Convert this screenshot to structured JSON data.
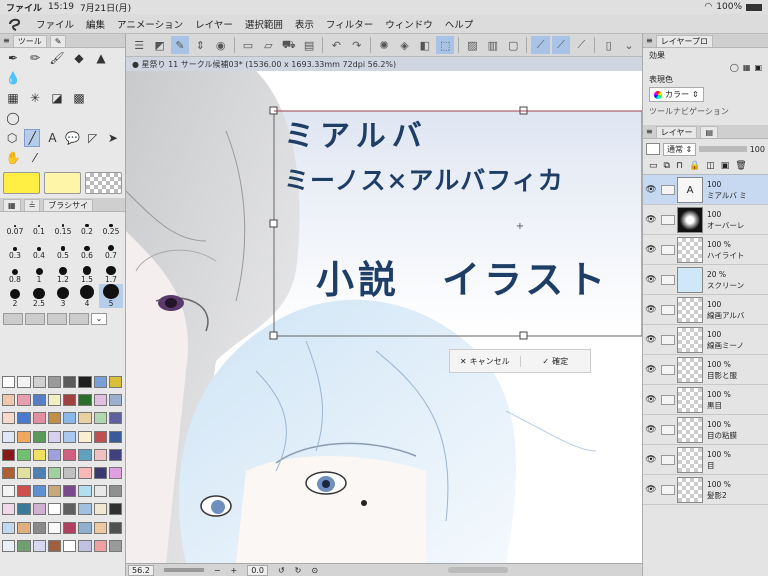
{
  "status": {
    "app": "ファイル",
    "time": "15:19",
    "date": "7月21日(月)",
    "battery": "100%"
  },
  "menu": [
    "ファイル",
    "編集",
    "アニメーション",
    "レイヤー",
    "選択範囲",
    "表示",
    "フィルター",
    "ウィンドウ",
    "ヘルプ"
  ],
  "document": {
    "tab": "● 星祭り 11 サークル候補03* (1536.00 x 1693.33mm 72dpi 56.2%)"
  },
  "left_panel": {
    "tab_tool": "ツール",
    "brush_tab": "ブラシサイ",
    "brush_sizes": [
      "0.07",
      "0.1",
      "0.15",
      "0.2",
      "0.25",
      "0.3",
      "0.4",
      "0.5",
      "0.6",
      "0.7",
      "0.8",
      "1",
      "1.2",
      "1.5",
      "1.7",
      "2",
      "2.5",
      "3",
      "4",
      "5"
    ]
  },
  "colors": {
    "main": "#ffee44",
    "sub": "#fff5a8",
    "accent": "#a9c3e6"
  },
  "palette": [
    "#ffffff",
    "#f2f2f2",
    "#d0d0d0",
    "#9a9a9a",
    "#5a5a5a",
    "#1f1f1f",
    "#7a9fd8",
    "#d8c03a",
    "#f2c9a8",
    "#e8a0b0",
    "#5580c8",
    "#f0f0c0",
    "#a04040",
    "#2a6e2a",
    "#e0c0e0",
    "#9ab0d0",
    "#f8d8c8",
    "#4a7ad0",
    "#e090a0",
    "#c09048",
    "#8ab8e8",
    "#e8d0a0",
    "#b0d8b0",
    "#6060a0",
    "#e0e8f8",
    "#f0a860",
    "#5a9a5a",
    "#d8d0f0",
    "#a8c8f0",
    "#f8f0d0",
    "#c05050",
    "#3a5a9a",
    "#8a1a1a",
    "#70c070",
    "#f0e060",
    "#a0a0e0",
    "#d06080",
    "#60a0c0",
    "#f0c0c0",
    "#404080",
    "#b06030",
    "#e0e0a0",
    "#5080b0",
    "#a0d0a0",
    "#c0c0c0",
    "#f8b8b8",
    "#3a3a70",
    "#e0a0e0",
    "#f4f4f4",
    "#d05050",
    "#6090d0",
    "#c8a878",
    "#7a4a8a",
    "#b0e0f0",
    "#e8e8e8",
    "#909090",
    "#f0d8e8",
    "#3a7a9a",
    "#d0b0d0",
    "#ffffff",
    "#606060",
    "#a0c0e0",
    "#f0e8d0",
    "#303030",
    "#c0d8f0",
    "#e0b080",
    "#8a8a8a",
    "#f8f8f8",
    "#b04060",
    "#90b0d0",
    "#f0c8a0",
    "#505050",
    "#e8f0f8",
    "#70a070",
    "#d8d8f0",
    "#a06040",
    "#ffffff",
    "#c0c0e0",
    "#f0a0a0",
    "#9a9a9a"
  ],
  "artwork": {
    "line1": "ミアルバ",
    "line2": "ミーノス×アルバフィカ",
    "line3": "小説　イラスト"
  },
  "transform": {
    "cancel": "キャンセル",
    "confirm": "確定"
  },
  "bottom": {
    "zoom": "56.2",
    "rot": "0.0"
  },
  "right_panel": {
    "layer_prop_tab": "レイヤープロ",
    "effect_label": "効果",
    "display_color_label": "表現色",
    "display_color_value": "カラー",
    "tool_nav": "ツールナビゲーション",
    "layer_tab": "レイヤー",
    "blend_mode": "通常",
    "opacity": "100"
  },
  "layers": [
    {
      "op": "100",
      "name": "ミアルバ ミ",
      "type": "text",
      "sel": true
    },
    {
      "op": "100",
      "name": "オーバーレ",
      "type": "dark"
    },
    {
      "op": "100 %",
      "name": "ハイライト",
      "type": "trans"
    },
    {
      "op": "20 %",
      "name": "スクリーン",
      "type": "blue"
    },
    {
      "op": "100",
      "name": "線画アルバ",
      "type": "folder"
    },
    {
      "op": "100",
      "name": "線画ミーノ",
      "type": "folder"
    },
    {
      "op": "100 %",
      "name": "目影と服",
      "type": "trans"
    },
    {
      "op": "100 %",
      "name": "黒目",
      "type": "trans"
    },
    {
      "op": "100 %",
      "name": "目の粘膜",
      "type": "trans"
    },
    {
      "op": "100 %",
      "name": "目",
      "type": "trans"
    },
    {
      "op": "100 %",
      "name": "髪影2",
      "type": "trans"
    }
  ]
}
